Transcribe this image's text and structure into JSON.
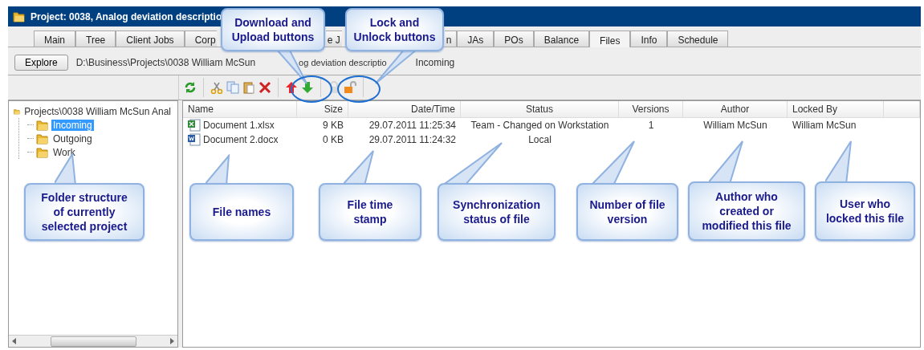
{
  "window": {
    "title": "Project: 0038, Analog deviation descriptio"
  },
  "tabs": [
    {
      "label": "Main",
      "selected": false
    },
    {
      "label": "Tree",
      "selected": false
    },
    {
      "label": "Client Jobs",
      "selected": false
    },
    {
      "label": "Corp",
      "selected": false
    },
    {
      "label": "e J",
      "selected": false
    },
    {
      "label": "n",
      "selected": false
    },
    {
      "label": "JAs",
      "selected": false
    },
    {
      "label": "POs",
      "selected": false
    },
    {
      "label": "Balance",
      "selected": false
    },
    {
      "label": "Files",
      "selected": true
    },
    {
      "label": "Info",
      "selected": false
    },
    {
      "label": "Schedule",
      "selected": false
    }
  ],
  "path_bar": {
    "button": "Explore",
    "path_segments": [
      "D:\\Business\\Projects\\0038 William McSun",
      "og deviation descriptio",
      "Incoming"
    ]
  },
  "toolbar": [
    {
      "kind": "refresh"
    },
    {
      "kind": "separator"
    },
    {
      "kind": "cut"
    },
    {
      "kind": "copy"
    },
    {
      "kind": "paste"
    },
    {
      "kind": "delete"
    },
    {
      "kind": "separator"
    },
    {
      "kind": "upload"
    },
    {
      "kind": "download"
    },
    {
      "kind": "separator"
    },
    {
      "kind": "lock",
      "disabled": true
    },
    {
      "kind": "unlock",
      "disabled": false
    },
    {
      "kind": "separator"
    }
  ],
  "folder_tree": {
    "label": "Projects\\0038 William McSun Anal",
    "selected": false,
    "children": [
      {
        "label": "Incoming",
        "selected": true
      },
      {
        "label": "Outgoing",
        "selected": false
      },
      {
        "label": "Work",
        "selected": false
      }
    ]
  },
  "file_table": {
    "columns": [
      "Name",
      "Size",
      "Date/Time",
      "Status",
      "Versions",
      "Author",
      "Locked By"
    ],
    "rows": [
      {
        "kind": "spreadsheet",
        "cells": [
          "Document 1.xlsx",
          "9 KB",
          "29.07.2011 11:25:34",
          "Team - Changed on Workstation",
          "1",
          "William McSun",
          "William McSun"
        ]
      },
      {
        "kind": "document",
        "cells": [
          "Document 2.docx",
          "0 KB",
          "29.07.2011 11:24:32",
          "Local"
        ]
      }
    ]
  },
  "callouts": [
    {
      "lines": [
        "Download and",
        "Upload buttons"
      ]
    },
    {
      "lines": [
        "Lock and",
        "Unlock buttons"
      ]
    },
    {
      "lines": [
        "Folder structure",
        "of currently",
        "selected project"
      ]
    },
    {
      "lines": [
        "File names"
      ]
    },
    {
      "lines": [
        "File time",
        "stamp"
      ]
    },
    {
      "lines": [
        "Synchronization",
        "status of file"
      ]
    },
    {
      "lines": [
        "Number of file",
        "version"
      ]
    },
    {
      "lines": [
        "Author who",
        "created or",
        "modified this file"
      ]
    },
    {
      "lines": [
        "User who",
        "locked this file"
      ]
    }
  ]
}
